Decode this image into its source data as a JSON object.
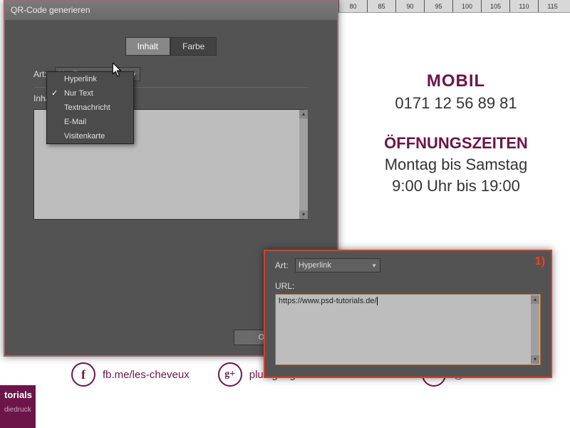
{
  "ruler": [
    "80",
    "85",
    "90",
    "95",
    "100",
    "105",
    "110",
    "115"
  ],
  "bg": {
    "mobil_title": "MOBIL",
    "mobil_num": "0171 12 56 89 81",
    "zeiten_title": "ÖFFNUNGSZEITEN",
    "zeiten_line1": "Montag bis Samstag",
    "zeiten_line2": "9:00 Uhr bis 19:00"
  },
  "dialog1": {
    "title": "QR-Code generieren",
    "tab_inhalt": "Inhalt",
    "tab_farbe": "Farbe",
    "label_art": "Art:",
    "label_inhalt": "Inhalt:",
    "select_value": "Nur Text",
    "btn_ok": "OK",
    "dropdown": {
      "item0": "Hyperlink",
      "item1": "Nur Text",
      "item2": "Textnachricht",
      "item3": "E-Mail",
      "item4": "Visitenkarte",
      "selected_index": 1
    }
  },
  "dialog2": {
    "label_art": "Art:",
    "select_value": "Hyperlink",
    "url_label": "URL:",
    "url_value": "https://www.psd-tutorials.de/",
    "badge": "1)"
  },
  "social": {
    "fb_text": "fb.me/les-cheveux",
    "gp_text": "plus.google.com/+les-cheveux",
    "tw_text": "@les-cheveux"
  },
  "watermark": {
    "l1": "torials",
    "l2": "diedruck"
  }
}
